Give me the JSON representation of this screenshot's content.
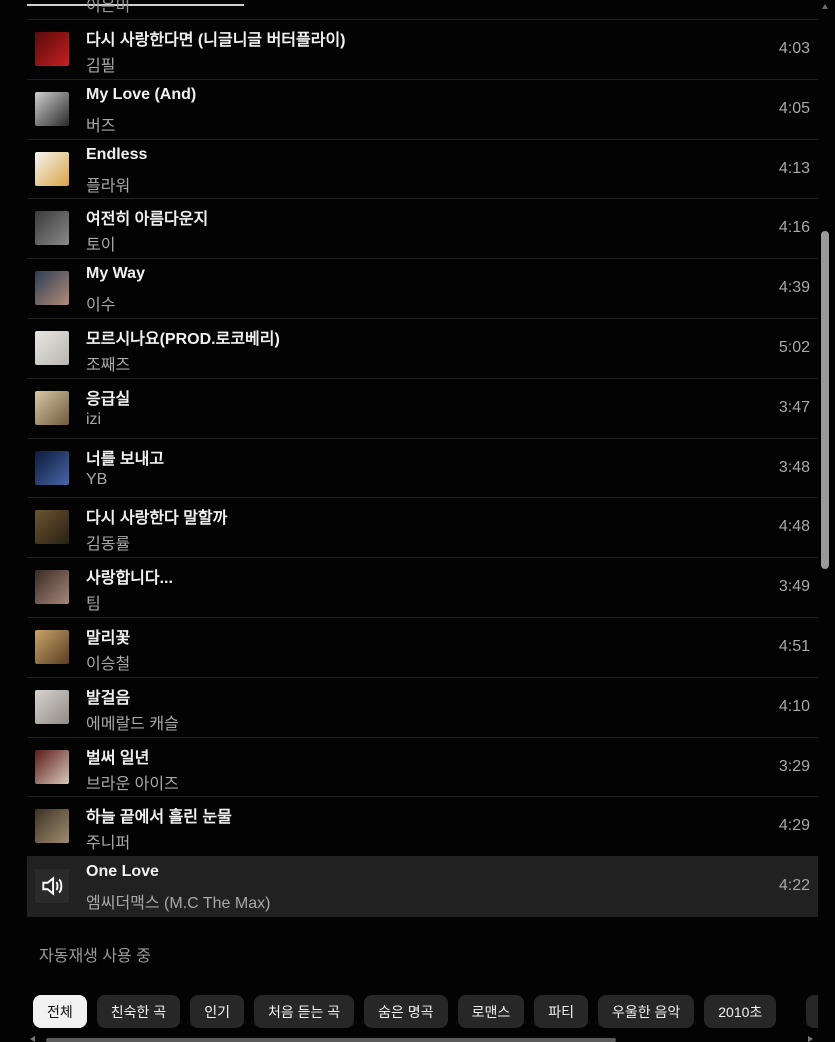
{
  "queue": {
    "previous_artist": "이은미",
    "tracks": [
      {
        "title": "다시 사랑한다면 (니글니글 버터플라이)",
        "artist": "김필",
        "duration": "4:03",
        "thumb_colors": [
          "#5a0b0b",
          "#c62020"
        ]
      },
      {
        "title": "My Love (And)",
        "artist": "버즈",
        "duration": "4:05",
        "thumb_colors": [
          "#cfcfcf",
          "#2a2a2a"
        ]
      },
      {
        "title": "Endless",
        "artist": "플라워",
        "duration": "4:13",
        "thumb_colors": [
          "#f4f4f4",
          "#d9a441"
        ]
      },
      {
        "title": "여전히 아름다운지",
        "artist": "토이",
        "duration": "4:16",
        "thumb_colors": [
          "#3a3a3a",
          "#8a8a8a"
        ]
      },
      {
        "title": "My Way",
        "artist": "이수",
        "duration": "4:39",
        "thumb_colors": [
          "#2b3f55",
          "#b48a78"
        ]
      },
      {
        "title": "모르시나요(PROD.로코베리)",
        "artist": "조째즈",
        "duration": "5:02",
        "thumb_colors": [
          "#e8e6e2",
          "#b9b6b0"
        ]
      },
      {
        "title": "응급실",
        "artist": "izi",
        "duration": "3:47",
        "thumb_colors": [
          "#d8c9a6",
          "#6e5a3c"
        ]
      },
      {
        "title": "너를 보내고",
        "artist": "YB",
        "duration": "3:48",
        "thumb_colors": [
          "#0d1a3a",
          "#4866a8"
        ]
      },
      {
        "title": "다시 사랑한다 말할까",
        "artist": "김동률",
        "duration": "4:48",
        "thumb_colors": [
          "#6b5330",
          "#2a2015"
        ]
      },
      {
        "title": "사랑합니다...",
        "artist": "팀",
        "duration": "3:49",
        "thumb_colors": [
          "#3a2a25",
          "#a8877a"
        ]
      },
      {
        "title": "말리꽃",
        "artist": "이승철",
        "duration": "4:51",
        "thumb_colors": [
          "#c9a36a",
          "#5a3e22"
        ]
      },
      {
        "title": "발걸음",
        "artist": "에메랄드 캐슬",
        "duration": "4:10",
        "thumb_colors": [
          "#d7d3cf",
          "#8f8a86"
        ]
      },
      {
        "title": "벌써 일년",
        "artist": "브라운 아이즈",
        "duration": "3:29",
        "thumb_colors": [
          "#5a1a1a",
          "#d9c8b8"
        ]
      },
      {
        "title": "하늘 끝에서 흘린 눈물",
        "artist": "주니퍼",
        "duration": "4:29",
        "thumb_colors": [
          "#3d3225",
          "#a08d6e"
        ]
      },
      {
        "title": "One Love",
        "artist": "엠씨더맥스 (M.C The Max)",
        "duration": "4:22",
        "playing": true,
        "thumb_icon": "speaker-icon"
      }
    ]
  },
  "autoplay_label": "자동재생 사용 중",
  "chips": [
    {
      "label": "전체",
      "active": true
    },
    {
      "label": "친숙한 곡"
    },
    {
      "label": "인기"
    },
    {
      "label": "처음 듣는 곡"
    },
    {
      "label": "숨은 명곡"
    },
    {
      "label": "로맨스"
    },
    {
      "label": "파티"
    },
    {
      "label": "우울한 음악"
    },
    {
      "label": "2010초"
    }
  ]
}
